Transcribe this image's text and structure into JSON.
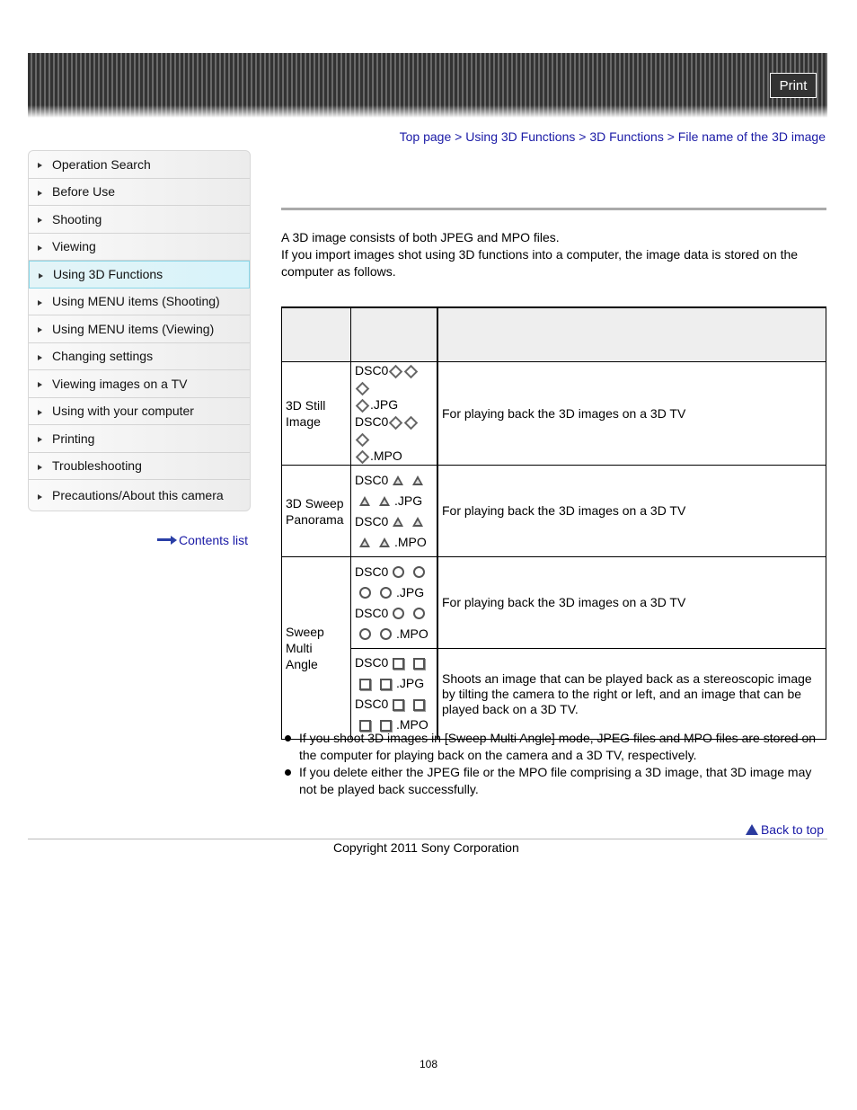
{
  "header": {
    "print_label": "Print"
  },
  "sidebar": {
    "items": [
      {
        "label": "Operation Search",
        "active": false
      },
      {
        "label": "Before Use",
        "active": false
      },
      {
        "label": "Shooting",
        "active": false
      },
      {
        "label": "Viewing",
        "active": false
      },
      {
        "label": "Using 3D Functions",
        "active": true
      },
      {
        "label": "Using MENU items (Shooting)",
        "active": false
      },
      {
        "label": "Using MENU items (Viewing)",
        "active": false
      },
      {
        "label": "Changing settings",
        "active": false
      },
      {
        "label": "Viewing images on a TV",
        "active": false
      },
      {
        "label": "Using with your computer",
        "active": false
      },
      {
        "label": "Printing",
        "active": false
      },
      {
        "label": "Troubleshooting",
        "active": false
      },
      {
        "label": "Precautions/About this camera",
        "active": false
      }
    ],
    "contents_link": "Contents list"
  },
  "breadcrumb": {
    "items": [
      "Top page",
      "Using 3D Functions",
      "3D Functions",
      "File name of the 3D image"
    ],
    "separator": ">"
  },
  "intro": {
    "line1": "A 3D image consists of both JPEG and MPO files.",
    "line2": "If you import images shot using 3D functions into a computer, the image data is stored on the computer as follows."
  },
  "table": {
    "headers": [
      "",
      "",
      ""
    ],
    "rows": [
      {
        "mode": "3D Still Image",
        "prefix": "DSC0",
        "symbol": "diamond",
        "jpg": ".JPG",
        "mpo": ".MPO",
        "description": "For playing back the 3D images on a 3D TV"
      },
      {
        "mode": "3D Sweep Panorama",
        "prefix": "DSC0",
        "symbol": "triangle",
        "jpg": ".JPG",
        "mpo": ".MPO",
        "description": "For playing back the 3D images on a 3D TV"
      },
      {
        "mode": "Sweep Multi Angle",
        "prefix": "DSC0",
        "symbol": "circle",
        "jpg": ".JPG",
        "mpo": ".MPO",
        "description": "For playing back the 3D images on a 3D TV"
      },
      {
        "mode": "",
        "prefix": "DSC0",
        "symbol": "square",
        "jpg": ".JPG",
        "mpo": ".MPO",
        "description": "Shoots an image that can be played back as a stereoscopic image by tilting the camera to the right or left, and an image that can be played back on a 3D TV."
      }
    ]
  },
  "notes": [
    "If you shoot 3D images in [Sweep Multi Angle] mode, JPEG files and MPO files are stored on the computer for playing back on the camera and a 3D TV, respectively.",
    "If you delete either the JPEG file or the MPO file comprising a 3D image, that 3D image may not be played back successfully."
  ],
  "footer": {
    "back_to_top": "Back to top",
    "copyright": "Copyright 2011 Sony Corporation",
    "page_number": "108"
  },
  "colors": {
    "link": "#1a1aa6",
    "active_nav": "#d7f3fa",
    "header_dark": "#333333"
  }
}
